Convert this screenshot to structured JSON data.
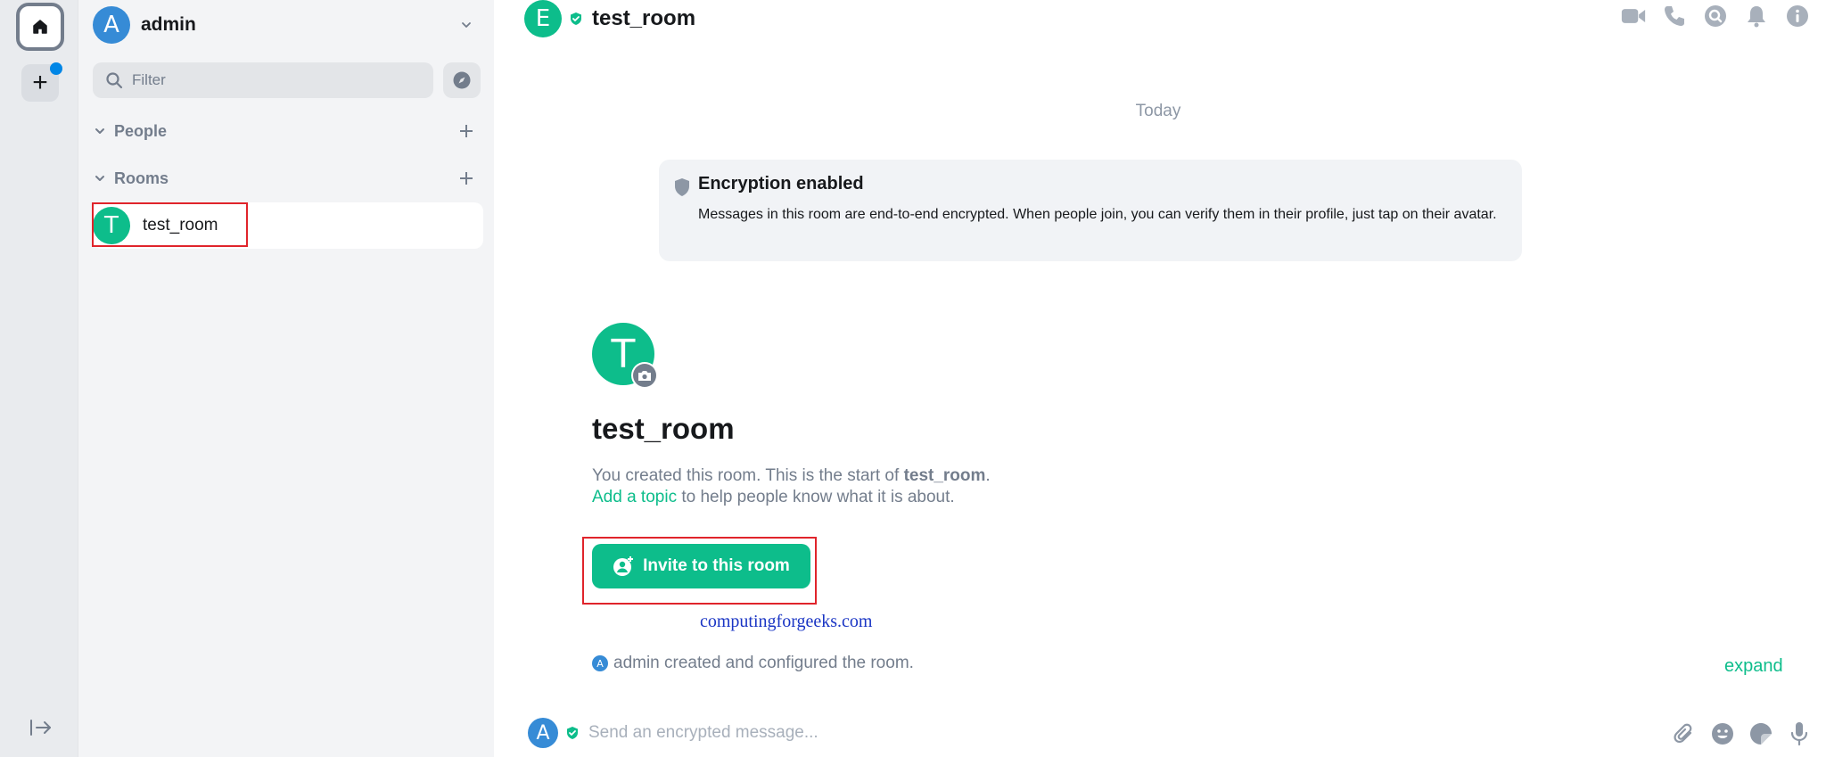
{
  "space_rail": {
    "home_icon": "home-icon",
    "create_space_label": "+",
    "collapse_icon": "expand-panel-icon"
  },
  "account": {
    "avatar_letter": "A",
    "name": "admin",
    "menu_icon": "chevron-down-icon"
  },
  "filter": {
    "placeholder": "Filter"
  },
  "sections": {
    "people": "People",
    "rooms": "Rooms"
  },
  "rooms": [
    {
      "avatar_letter": "T",
      "name": "test_room"
    }
  ],
  "header": {
    "avatar_letter": "E",
    "title": "test_room",
    "icons": [
      "video-call-icon",
      "voice-call-icon",
      "search-icon",
      "notifications-icon",
      "room-info-icon"
    ]
  },
  "timeline": {
    "date_separator": "Today",
    "encryption": {
      "title": "Encryption enabled",
      "body": "Messages in this room are end-to-end encrypted. When people join, you can verify them in their profile, just tap on their avatar."
    },
    "intro": {
      "avatar_letter": "T",
      "title": "test_room",
      "created_prefix": "You created this room. This is the start of ",
      "room_name": "test_room",
      "created_suffix": ".",
      "add_topic_link": "Add a topic",
      "topic_suffix": " to help people know what it is about.",
      "invite_button": "Invite to this room"
    },
    "watermark": "computingforgeeks.com",
    "event": {
      "avatar_letter": "A",
      "text": "admin created and configured the room.",
      "expand_link": "expand"
    }
  },
  "composer": {
    "avatar_letter": "A",
    "placeholder": "Send an encrypted message...",
    "icons": [
      "attachment-icon",
      "emoji-icon",
      "sticker-icon",
      "microphone-icon"
    ]
  },
  "colors": {
    "accent": "#0dbd8b",
    "avatar_blue": "#368bd6",
    "highlight_box": "#e0242b",
    "notification_dot": "#0086e6"
  }
}
